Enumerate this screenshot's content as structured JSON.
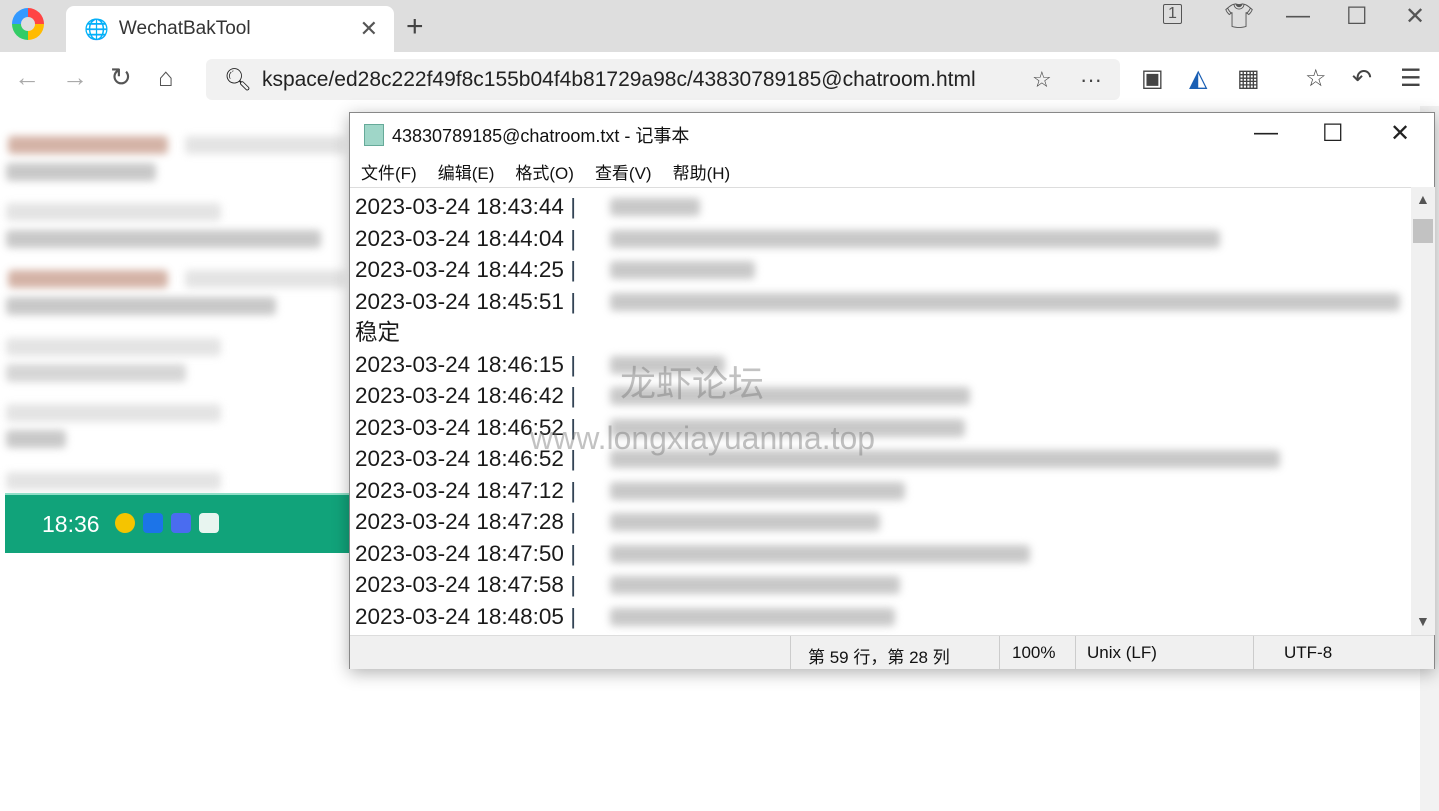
{
  "browser": {
    "tab_title": "WechatBakTool",
    "tab_count": "1",
    "address": "kspace/ed28c222f49f8c155b04f4b81729a98c/43830789185@chatroom.html"
  },
  "page": {
    "time": "18:36"
  },
  "notepad": {
    "title": "43830789185@chatroom.txt - 记事本",
    "menu": [
      "文件(F)",
      "编辑(E)",
      "格式(O)",
      "查看(V)",
      "帮助(H)"
    ],
    "lines": [
      {
        "ts": "2023-03-24 18:43:44"
      },
      {
        "ts": "2023-03-24 18:44:04"
      },
      {
        "ts": "2023-03-24 18:44:25"
      },
      {
        "ts": "2023-03-24 18:45:51"
      },
      {
        "text": "稳定"
      },
      {
        "ts": "2023-03-24 18:46:15"
      },
      {
        "ts": "2023-03-24 18:46:42"
      },
      {
        "ts": "2023-03-24 18:46:52"
      },
      {
        "ts": "2023-03-24 18:46:52"
      },
      {
        "ts": "2023-03-24 18:47:12"
      },
      {
        "ts": "2023-03-24 18:47:28"
      },
      {
        "ts": "2023-03-24 18:47:50"
      },
      {
        "ts": "2023-03-24 18:47:58"
      },
      {
        "ts": "2023-03-24 18:48:05"
      }
    ],
    "status": {
      "position": "第 59 行，第 28 列",
      "zoom": "100%",
      "eol": "Unix (LF)",
      "encoding": "UTF-8"
    }
  },
  "watermark": {
    "cn": "龙虾论坛",
    "url": "www.longxiayuanma.top"
  }
}
